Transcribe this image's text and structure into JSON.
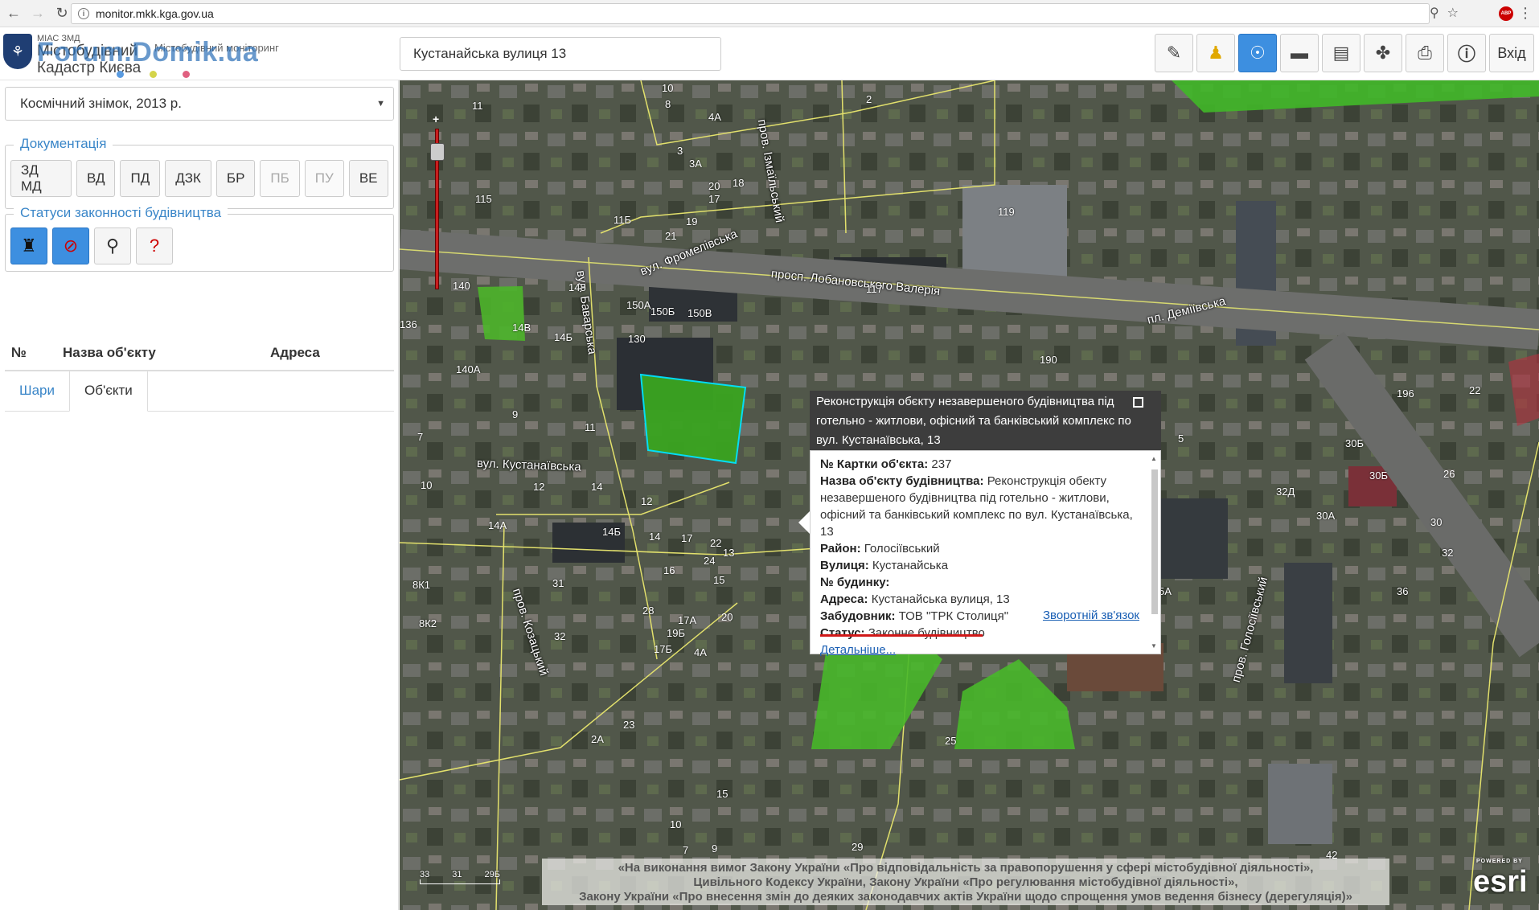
{
  "browser": {
    "url": "monitor.mkk.kga.gov.ua"
  },
  "header": {
    "logo_small": "МІАС ЗМД",
    "logo_line1": "Містобудівний",
    "logo_line2": "Кадастр Києва",
    "logo_subtitle": "Містобудівний моніторинг",
    "watermark": "Forum.Domik.ua",
    "search_value": "Кустанайська вулиця 13",
    "login_label": "Вхід"
  },
  "sidebar": {
    "basemap": "Космічний знімок, 2013 р.",
    "docs_legend": "Документація",
    "doc_buttons": [
      "ЗД МД",
      "ВД",
      "ПД",
      "ДЗК",
      "БР",
      "ПБ",
      "ПУ",
      "ВЕ"
    ],
    "status_legend": "Статуси законності будівництва",
    "tabs": [
      "Шари",
      "Об'єкти"
    ],
    "table_headers": [
      "№",
      "Назва об'єкту",
      "Адреса"
    ]
  },
  "map": {
    "streets": [
      "вул. Фромелівська",
      "пров. Ізмаїльський",
      "просп. Лобановського Валерія",
      "пл. Деміївська",
      "вул. Баварська",
      "вул. Кустанаївська",
      "пров. Козацький",
      "пров. Голосіївський"
    ],
    "popup": {
      "title": "Реконструкція обєкту незавершеного будівництва під готельно - житлови, офісний та банківський комплекс по вул. Кустанаївська, 13",
      "card_label": "№ Картки об'єкта:",
      "card_value": "237",
      "name_label": "Назва об'єкту будівництва:",
      "name_value": "Реконструкція обекту незавершеного будівництва під готельно - житлови, офісний та банківський комплекс по вул. Кустанаївська, 13",
      "district_label": "Район:",
      "district_value": "Голосіївський",
      "street_label": "Вулиця:",
      "street_value": "Кустанайська",
      "building_label": "№ будинку:",
      "address_label": "Адреса:",
      "address_value": "Кустанайська вулиця, 13",
      "developer_label": "Забудовник:",
      "developer_value": "ТОВ \"ТРК Столиця\"",
      "feedback_link": "Зворотній зв'язок",
      "status_label": "Статус:",
      "status_value": "Законне будівництво",
      "details_link": "Детальніше..."
    },
    "legal_line1": "«На виконання вимог Закону України «Про відповідальність за правопорушення у сфері містобудівної діяльності»,",
    "legal_line2": "Цивільного Кодексу України, Закону України «Про регулювання містобудівної діяльності»,",
    "legal_line3": "Закону України «Про внесення змін до деяких законодавчих актів України щодо спрощення умов ведення бізнесу (дерегуляція)»",
    "scale_labels": [
      "33",
      "31",
      "29Б"
    ],
    "esri_powered": "POWERED BY",
    "esri": "esri",
    "building_labels": [
      "10",
      "8",
      "11",
      "115",
      "4А",
      "2",
      "3",
      "3А",
      "20",
      "18",
      "17",
      "11Б",
      "21",
      "19",
      "119",
      "117",
      "140",
      "136",
      "148",
      "14В",
      "14Б",
      "150А",
      "150Б",
      "150В",
      "130",
      "140А",
      "9",
      "11",
      "7",
      "10",
      "12",
      "14",
      "12",
      "14А",
      "14Б",
      "14",
      "16",
      "17",
      "22",
      "24",
      "13",
      "15",
      "31",
      "8К1",
      "8К2",
      "32",
      "28",
      "17А",
      "19Б",
      "17Б",
      "4А",
      "190",
      "196",
      "22",
      "5",
      "30Б",
      "30Б",
      "26",
      "7",
      "32Д",
      "30А",
      "30",
      "32",
      "36",
      "5А",
      "42",
      "12",
      "25",
      "2А",
      "23",
      "9",
      "15",
      "10",
      "7",
      "29",
      "20"
    ]
  }
}
